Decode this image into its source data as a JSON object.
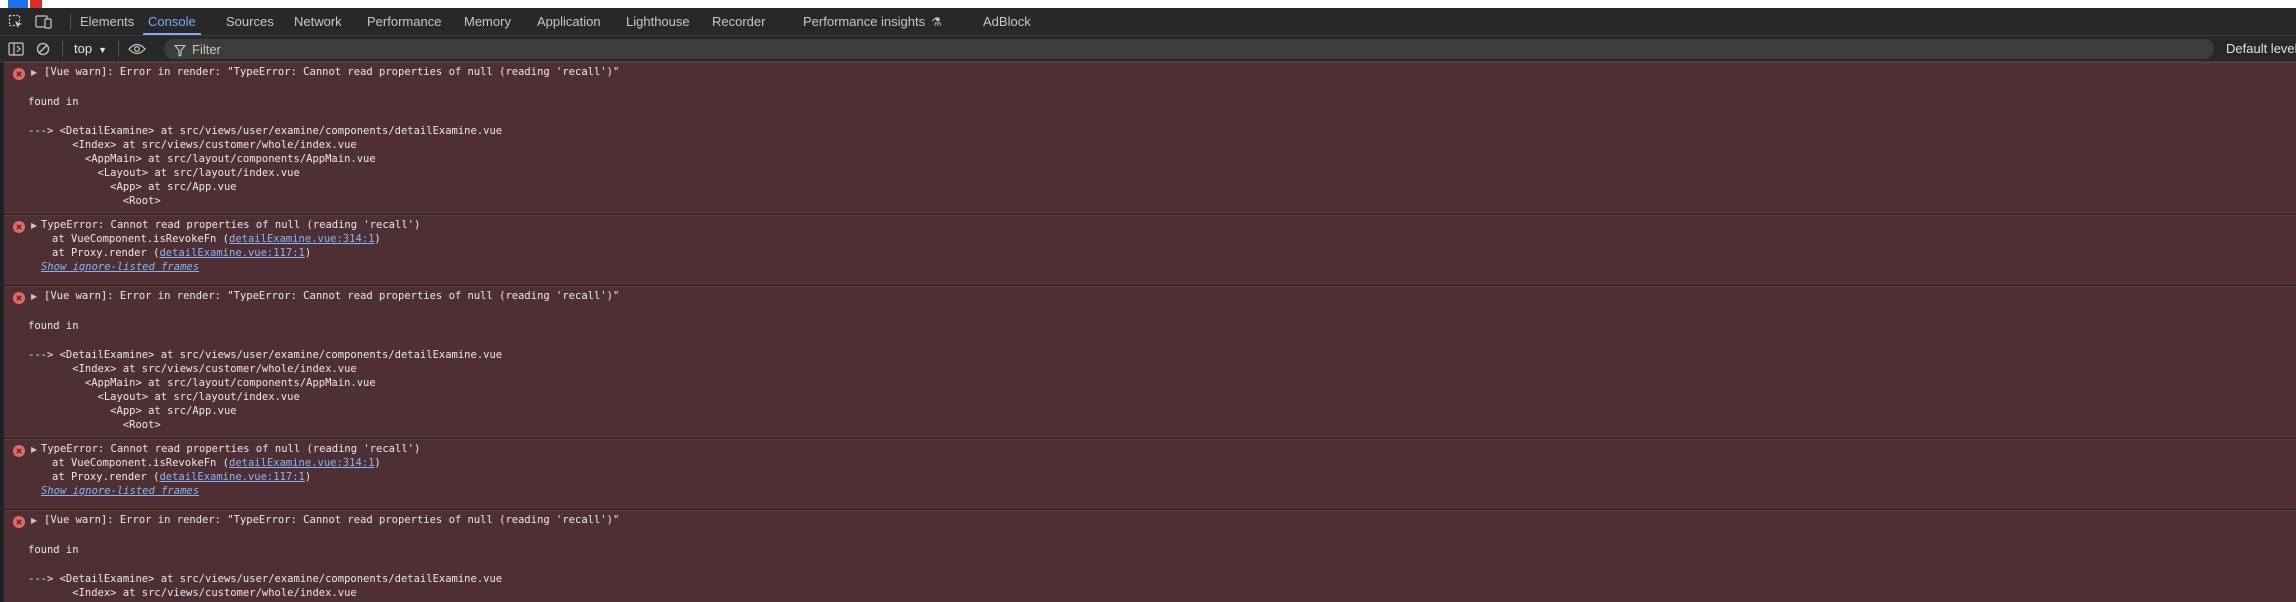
{
  "devtools": {
    "tabs": [
      "Elements",
      "Console",
      "Sources",
      "Network",
      "Performance",
      "Memory",
      "Application",
      "Lighthouse",
      "Recorder",
      "Performance insights",
      "AdBlock"
    ],
    "active_tab": "Console",
    "icons": {
      "inspect": "inspect-element-icon",
      "device": "device-toolbar-icon",
      "performance_insights": "flask-icon"
    }
  },
  "toolbar": {
    "context": "top",
    "filter_placeholder": "Filter",
    "levels_label": "Default levels",
    "icons": [
      "sidebar-toggle-icon",
      "clear-console-icon",
      "eye-icon",
      "filter-icon"
    ]
  },
  "messages": [
    {
      "type": "vue-warn",
      "summary": "[Vue warn]: Error in render: \"TypeError: Cannot read properties of null (reading 'recall')\"",
      "found_in": "found in",
      "trace": [
        "---> <DetailExamine> at src/views/user/examine/components/detailExamine.vue",
        "       <Index> at src/views/customer/whole/index.vue",
        "         <AppMain> at src/layout/components/AppMain.vue",
        "           <Layout> at src/layout/index.vue",
        "             <App> at src/App.vue",
        "               <Root>"
      ]
    },
    {
      "type": "type-error",
      "summary": "TypeError: Cannot read properties of null (reading 'recall')",
      "stack": [
        {
          "prefix": "at VueComponent.isRevokeFn (",
          "link": "detailExamine.vue:314:1",
          "suffix": ")"
        },
        {
          "prefix": "at Proxy.render (",
          "link": "detailExamine.vue:117:1",
          "suffix": ")"
        }
      ],
      "show_ignored": "Show ignore-listed frames"
    },
    {
      "type": "vue-warn",
      "summary": "[Vue warn]: Error in render: \"TypeError: Cannot read properties of null (reading 'recall')\"",
      "found_in": "found in",
      "trace": [
        "---> <DetailExamine> at src/views/user/examine/components/detailExamine.vue",
        "       <Index> at src/views/customer/whole/index.vue",
        "         <AppMain> at src/layout/components/AppMain.vue",
        "           <Layout> at src/layout/index.vue",
        "             <App> at src/App.vue",
        "               <Root>"
      ]
    },
    {
      "type": "type-error",
      "summary": "TypeError: Cannot read properties of null (reading 'recall')",
      "stack": [
        {
          "prefix": "at VueComponent.isRevokeFn (",
          "link": "detailExamine.vue:314:1",
          "suffix": ")"
        },
        {
          "prefix": "at Proxy.render (",
          "link": "detailExamine.vue:117:1",
          "suffix": ")"
        }
      ],
      "show_ignored": "Show ignore-listed frames"
    },
    {
      "type": "vue-warn",
      "summary": "[Vue warn]: Error in render: \"TypeError: Cannot read properties of null (reading 'recall')\"",
      "found_in": "found in",
      "trace": [
        "---> <DetailExamine> at src/views/user/examine/components/detailExamine.vue",
        "       <Index> at src/views/customer/whole/index.vue"
      ]
    }
  ],
  "colors": {
    "error_bg": "#4e3034",
    "error_icon": "#e46962",
    "link": "#8ab4f8",
    "active_tab": "#7cacf8"
  }
}
